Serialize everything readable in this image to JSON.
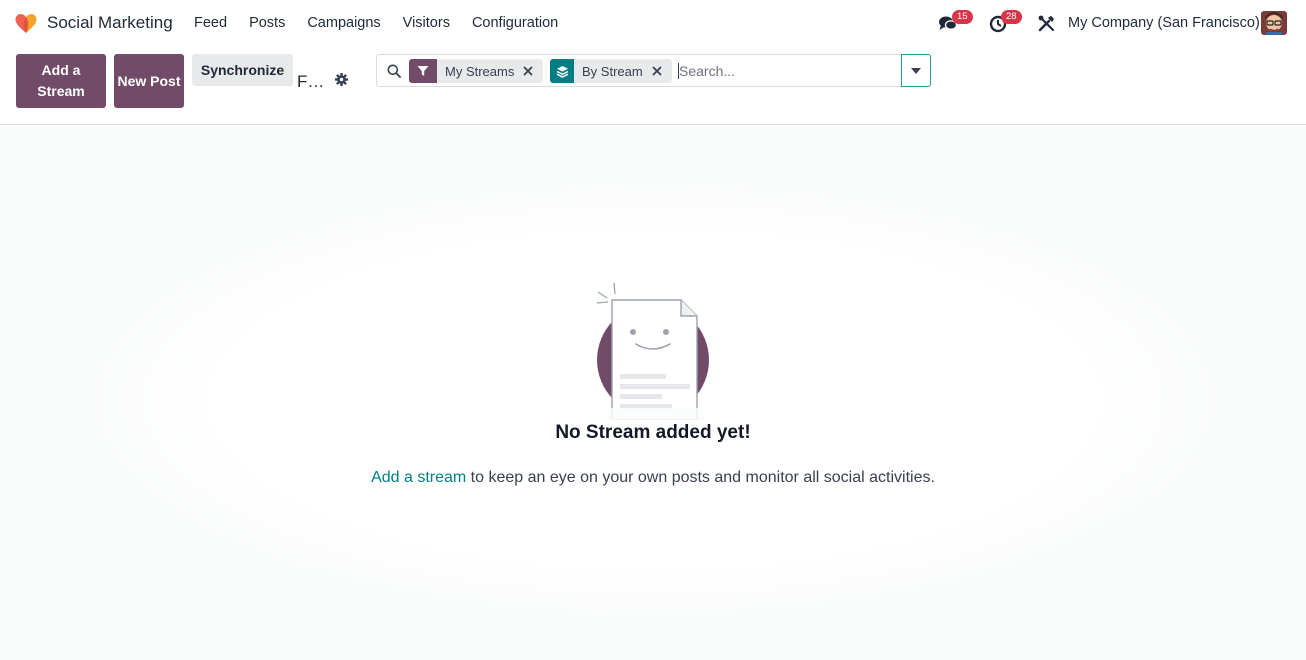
{
  "navbar": {
    "app_name": "Social Marketing",
    "menu": [
      "Feed",
      "Posts",
      "Campaigns",
      "Visitors",
      "Configuration"
    ],
    "messages_count": "15",
    "activities_count": "28",
    "company": "My Company (San Francisco)"
  },
  "control_panel": {
    "add_stream_label": "Add a Stream",
    "new_post_label": "New Post",
    "synchronize_label": "Synchronize",
    "breadcrumb_title": "F…"
  },
  "search": {
    "facets": [
      {
        "label": "My Streams",
        "icon": "filter-icon"
      },
      {
        "label": "By Stream",
        "icon": "layers-icon"
      }
    ],
    "placeholder": "Search..."
  },
  "empty_state": {
    "title": "No Stream added yet!",
    "link_text": "Add a stream",
    "text": " to keep an eye on your own posts and monitor all social activities."
  },
  "colors": {
    "primary": "#714b67",
    "link": "#017e84",
    "badge": "#d9344a",
    "filter_facet": "#714b67",
    "groupby_facet": "#017e84"
  }
}
